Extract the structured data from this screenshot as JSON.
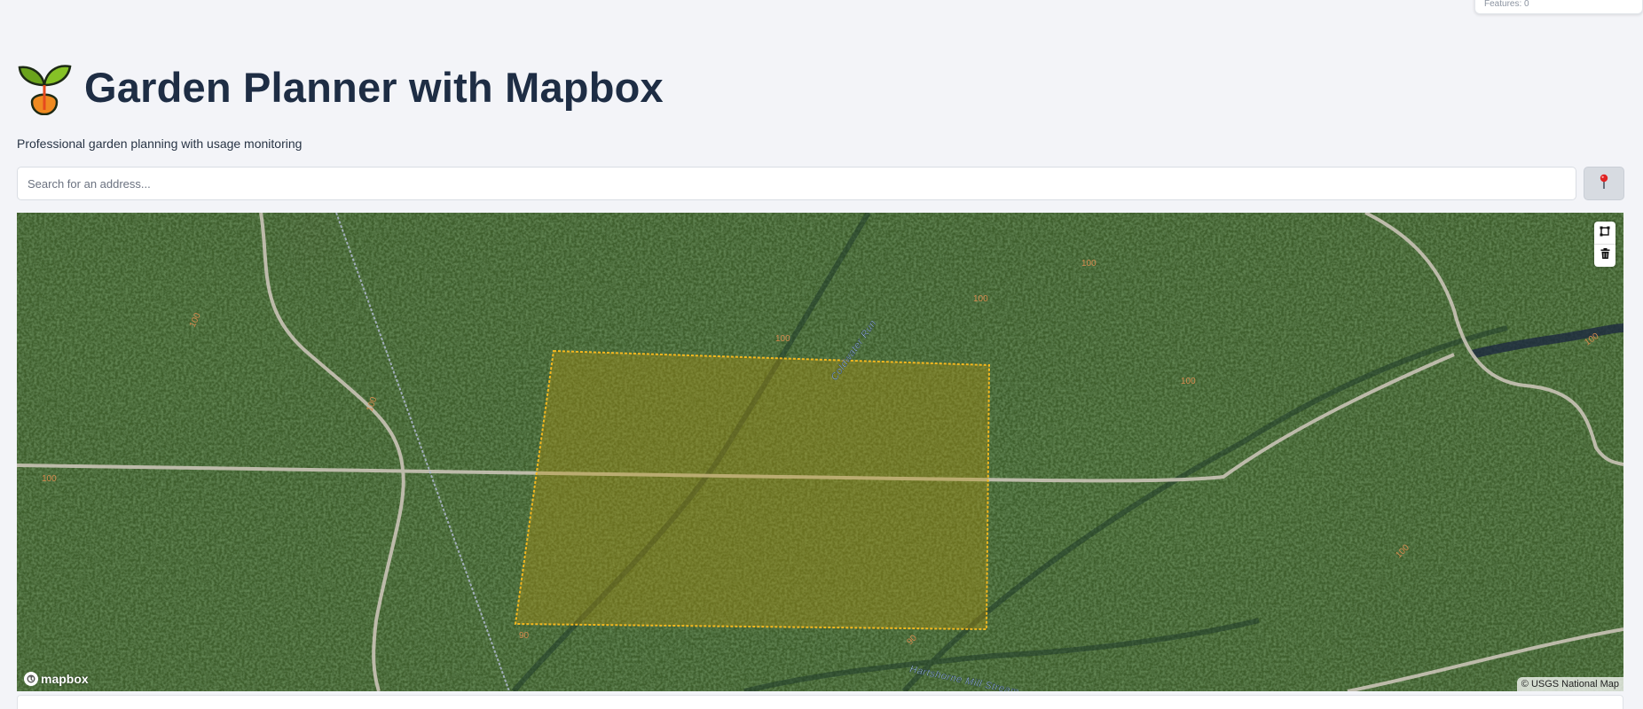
{
  "usage": {
    "text": "Features: 0"
  },
  "header": {
    "title": "Garden Planner with Mapbox",
    "logo_icon": "seedling-icon"
  },
  "subtitle": "Professional garden planning with usage monitoring",
  "search": {
    "placeholder": "Search for an address...",
    "value": "",
    "locate_icon": "pin-icon"
  },
  "map": {
    "style": "satellite",
    "labels": {
      "stream_north": "Coldwater Run",
      "stream_south": "Hartshorne Mill Stream",
      "contours": [
        "100",
        "100",
        "100",
        "100",
        "100",
        "100",
        "100",
        "100",
        "100",
        "90",
        "90"
      ]
    },
    "controls": {
      "polygon_tool": "polygon-icon",
      "trash_tool": "trash-icon"
    },
    "brand": "mapbox",
    "attribution": "© USGS National Map"
  },
  "colors": {
    "accent": "#f5b81f",
    "title": "#1e2d44",
    "background": "#f3f4f8"
  }
}
